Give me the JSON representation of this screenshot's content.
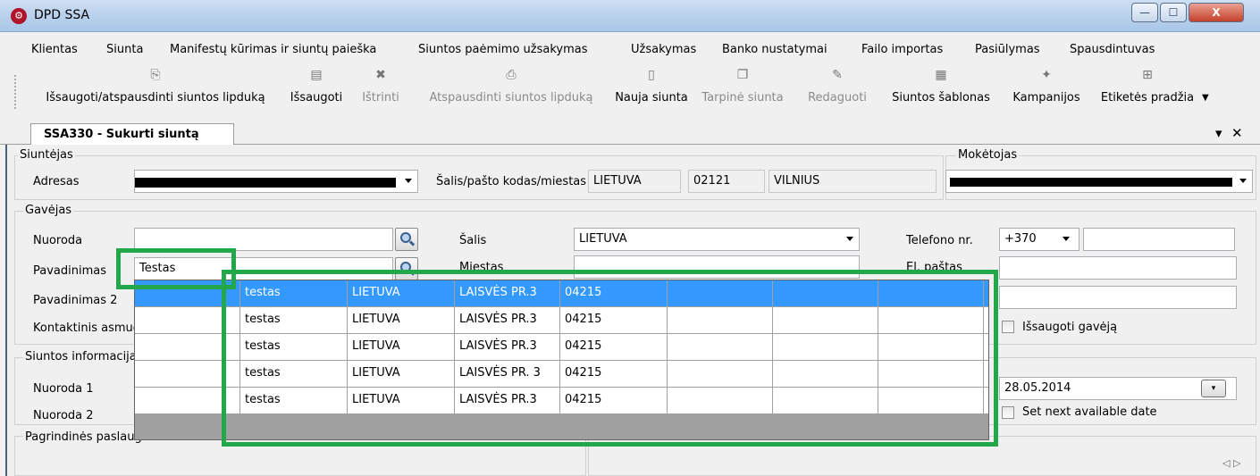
{
  "window": {
    "title": "DPD SSA",
    "min": "—",
    "max": "☐",
    "close": "X"
  },
  "menu": [
    "Klientas",
    "Siunta",
    "Manifestų kūrimas ir siuntų paieška",
    "Siuntos paėmimo užsakymas",
    "Užsakymas",
    "Banko nustatymai",
    "Failo importas",
    "Pasiūlymas",
    "Spausdintuvas"
  ],
  "toolbar": [
    {
      "label": "Išsaugoti/atspausdinti siuntos lipduką",
      "icon": "save-print-icon",
      "disabled": false
    },
    {
      "label": "Išsaugoti",
      "icon": "floppy-icon",
      "disabled": false
    },
    {
      "label": "Ištrinti",
      "icon": "delete-x-icon",
      "disabled": true
    },
    {
      "label": "Atspausdinti siuntos lipduką",
      "icon": "printer-icon",
      "disabled": true
    },
    {
      "label": "Nauja siunta",
      "icon": "new-document-icon",
      "disabled": false
    },
    {
      "label": "Tarpinė siunta",
      "icon": "copy-icon",
      "disabled": true
    },
    {
      "label": "Redaguoti",
      "icon": "pencil-icon",
      "disabled": true
    },
    {
      "label": "Siuntos šablonas",
      "icon": "template-icon",
      "disabled": false
    },
    {
      "label": "Kampanijos",
      "icon": "magic-wand-icon",
      "disabled": false
    },
    {
      "label": "Etiketės pradžia",
      "icon": "grid-icon",
      "disabled": false
    }
  ],
  "tab": {
    "label": "SSA330 - Sukurti siuntą",
    "dropdown": "▾",
    "close": "✕"
  },
  "sender": {
    "legend": "Siuntėjas",
    "address_label": "Adresas",
    "location_label": "Šalis/pašto kodas/miestas",
    "country": "LIETUVA",
    "postcode": "02121",
    "city": "VILNIUS"
  },
  "payer": {
    "legend": "Mokėtojas"
  },
  "recipient": {
    "legend": "Gavėjas",
    "reference_label": "Nuoroda",
    "name_label": "Pavadinimas",
    "name_value": "Testas",
    "name2_label": "Pavadinimas 2",
    "contact_label": "Kontaktinis asmuo",
    "country_label": "Šalis",
    "country_value": "LIETUVA",
    "city_label": "Miestas",
    "phone_label": "Telefono nr.",
    "phone_prefix": "+370",
    "email_label": "El. paštas",
    "save_recipient_label": "Išsaugoti gavėją"
  },
  "shipment": {
    "legend": "Siuntos informacija",
    "ref1_label": "Nuoroda 1",
    "ref2_label": "Nuoroda 2",
    "date": "28.05.2014",
    "next_date_label": "Set next available date"
  },
  "services": {
    "legend": "Pagrindinės paslaugos"
  },
  "suggestions": [
    [
      "",
      "testas",
      "LIETUVA",
      "LAISVĖS PR.3",
      "04215",
      "",
      "",
      ""
    ],
    [
      "",
      "testas",
      "LIETUVA",
      "LAISVĖS PR.3",
      "04215",
      "",
      "",
      ""
    ],
    [
      "",
      "testas",
      "LIETUVA",
      "LAISVĖS PR.3",
      "04215",
      "",
      "",
      ""
    ],
    [
      "",
      "testas",
      "LIETUVA",
      "LAISVĖS PR. 3",
      "04215",
      "",
      "",
      ""
    ],
    [
      "",
      "testas",
      "LIETUVA",
      "LAISVĖS PR.3",
      "04215",
      "",
      "",
      ""
    ]
  ],
  "colors": {
    "selection": "#3399ff",
    "highlight": "#22a74a"
  }
}
